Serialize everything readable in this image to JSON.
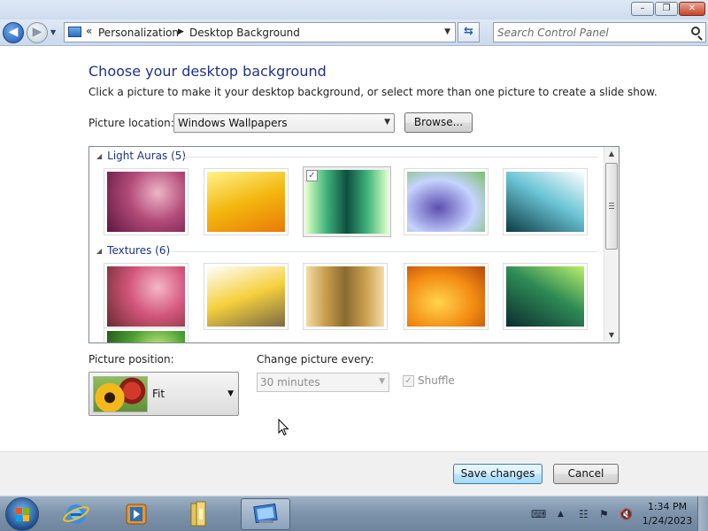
{
  "window": {
    "minimize_glyph": "–",
    "maximize_glyph": "❐",
    "close_glyph": "✕"
  },
  "address": {
    "overflow_glyph": "«",
    "crumbs": [
      "Personalization",
      "Desktop Background"
    ],
    "search_placeholder": "Search Control Panel"
  },
  "page": {
    "title": "Choose your desktop background",
    "description": "Click a picture to make it your desktop background, or select more than one picture to create a slide show.",
    "location_label": "Picture location:",
    "location_value": "Windows Wallpapers",
    "browse_label": "Browse..."
  },
  "gallery": {
    "groups": [
      {
        "title": "Light Auras (5)",
        "thumbs": [
          {
            "name": "light-aura-magenta",
            "colors": [
              "#ecb6c8",
              "#b34a78",
              "#5e1640"
            ],
            "selected": false
          },
          {
            "name": "light-aura-yellow",
            "colors": [
              "#fff38a",
              "#f3b70f",
              "#ea7a07"
            ],
            "selected": false
          },
          {
            "name": "light-aura-green",
            "colors": [
              "#d9ffc4",
              "#3fb37a",
              "#0d4f3f"
            ],
            "selected": true
          },
          {
            "name": "light-aura-prism",
            "colors": [
              "#5b4fb0",
              "#c7d3ff",
              "#7bc06a"
            ],
            "selected": false
          },
          {
            "name": "light-aura-teal",
            "colors": [
              "#ffffff",
              "#6cc5d6",
              "#0d3c45"
            ],
            "selected": false
          }
        ]
      },
      {
        "title": "Textures (6)",
        "thumbs": [
          {
            "name": "texture-pink-flower",
            "colors": [
              "#f5b7c8",
              "#d2567b",
              "#6a2a2f"
            ],
            "selected": false
          },
          {
            "name": "texture-frangipani",
            "colors": [
              "#ffffff",
              "#f6d03d",
              "#7b6a45"
            ],
            "selected": false
          },
          {
            "name": "texture-gold-pattern",
            "colors": [
              "#f4dca3",
              "#c89d4c",
              "#8b6a30"
            ],
            "selected": false
          },
          {
            "name": "texture-orange-gerbera",
            "colors": [
              "#ffd54d",
              "#f28a12",
              "#b4480c"
            ],
            "selected": false
          },
          {
            "name": "texture-green-leaves",
            "colors": [
              "#b7f06a",
              "#2e8a55",
              "#0b2d2f"
            ],
            "selected": false
          },
          {
            "name": "texture-green-fern",
            "colors": [
              "#d5f38d",
              "#4aa033",
              "#1b4416"
            ],
            "selected": false
          }
        ]
      }
    ],
    "check_glyph": "✓"
  },
  "options": {
    "position_label": "Picture position:",
    "position_value": "Fit",
    "interval_label": "Change picture every:",
    "interval_value": "30 minutes",
    "shuffle_label": "Shuffle",
    "shuffle_checked": true
  },
  "footer": {
    "save_label": "Save changes",
    "cancel_label": "Cancel"
  },
  "taskbar": {
    "time": "1:34 PM",
    "date": "1/24/2023",
    "icons": [
      "start-orb-icon",
      "internet-explorer-icon",
      "media-player-icon",
      "file-explorer-icon",
      "control-panel-icon"
    ],
    "tray_icons": [
      "keyboard-icon",
      "show-hidden-icons-arrow",
      "network-icon",
      "action-center-icon",
      "volume-muted-icon"
    ]
  },
  "colors": {
    "heading": "#1e3287",
    "taskbar": "#7e95ad"
  }
}
